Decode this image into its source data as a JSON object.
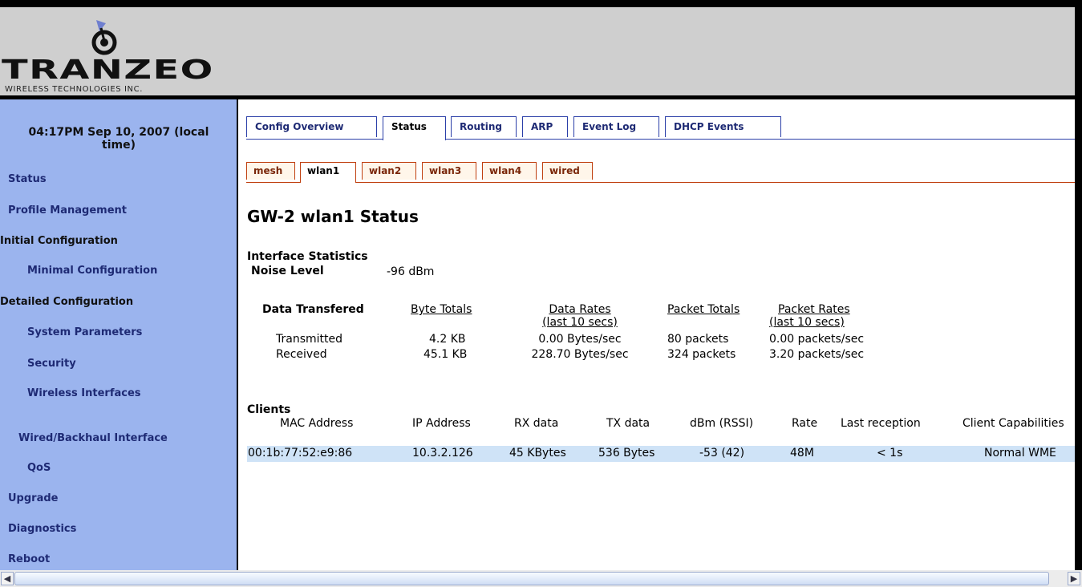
{
  "logo": {
    "name": "TRANZEO",
    "sub": "WIRELESS TECHNOLOGIES INC."
  },
  "sidebar": {
    "clock": "04:17PM Sep 10, 2007 (local time)",
    "items": [
      {
        "label": "Status"
      },
      {
        "label": "Profile Management"
      },
      {
        "label": "Initial Configuration"
      },
      {
        "label": "Minimal Configuration"
      },
      {
        "label": "Detailed Configuration"
      },
      {
        "label": "System Parameters"
      },
      {
        "label": "Security"
      },
      {
        "label": "Wireless Interfaces"
      },
      {
        "label": "Wired/Backhaul Interface"
      },
      {
        "label": "QoS"
      },
      {
        "label": "Upgrade"
      },
      {
        "label": "Diagnostics"
      },
      {
        "label": "Reboot"
      }
    ]
  },
  "tabs": [
    "Config Overview",
    "Status",
    "Routing",
    "ARP",
    "Event Log",
    "DHCP Events"
  ],
  "subtabs": [
    "mesh",
    "wlan1",
    "wlan2",
    "wlan3",
    "wlan4",
    "wired"
  ],
  "page_title": "GW-2 wlan1 Status",
  "interface": {
    "heading": "Interface Statistics",
    "noise_label": "Noise Level",
    "noise_value": "-96 dBm",
    "table": {
      "label": "Data Transfered",
      "headers": [
        "Byte Totals",
        "Data Rates",
        "(last 10 secs)",
        "Packet Totals",
        "Packet Rates",
        "(last 10 secs)"
      ],
      "rows": [
        {
          "name": "Transmitted",
          "bytes": "4.2 KB",
          "rate": "0.00 Bytes/sec",
          "packets": "80 packets",
          "prate": "0.00 packets/sec"
        },
        {
          "name": "Received",
          "bytes": "45.1 KB",
          "rate": "228.70 Bytes/sec",
          "packets": "324 packets",
          "prate": "3.20 packets/sec"
        }
      ]
    }
  },
  "clients": {
    "heading": "Clients",
    "headers": [
      "MAC Address",
      "IP Address",
      "RX data",
      "TX data",
      "dBm (RSSI)",
      "Rate",
      "Last reception",
      "Client Capabilities"
    ],
    "rows": [
      [
        "00:1b:77:52:e9:86",
        "10.3.2.126",
        "45 KBytes",
        "536 Bytes",
        "-53 (42)",
        "48M",
        "< 1s",
        "Normal WME"
      ]
    ]
  },
  "colors": {
    "sidebar": "#9bb4ee",
    "header": "#cfcfcf",
    "tab_border": "#2b3fa8",
    "subtab_border": "#c04010",
    "client_row": "#cfe3f7"
  }
}
